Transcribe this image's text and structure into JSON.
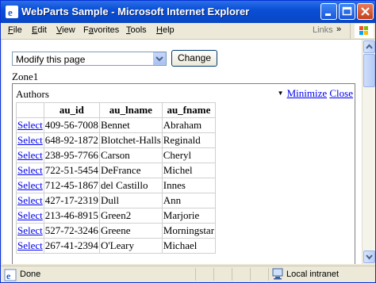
{
  "window": {
    "title": "WebParts Sample - Microsoft Internet Explorer"
  },
  "menu": {
    "items": [
      {
        "key": "F",
        "rest": "ile"
      },
      {
        "key": "E",
        "rest": "dit"
      },
      {
        "key": "V",
        "rest": "iew"
      },
      {
        "key": "F",
        "rest": "avorites",
        "pre": "F",
        "full": "Favorites"
      },
      {
        "key": "T",
        "rest": "ools"
      },
      {
        "key": "H",
        "rest": "elp"
      }
    ],
    "links_label": "Links",
    "chevron": "»"
  },
  "page": {
    "mode_select": {
      "value": "Modify this page"
    },
    "change_label": "Change",
    "zone_label": "Zone1",
    "part": {
      "title": "Authors",
      "verbs_arrow": "▼",
      "minimize_label": "Minimize",
      "close_label": "Close",
      "columns": [
        "",
        "au_id",
        "au_lname",
        "au_fname"
      ],
      "select_label": "Select",
      "rows": [
        [
          "409-56-7008",
          "Bennet",
          "Abraham"
        ],
        [
          "648-92-1872",
          "Blotchet-Halls",
          "Reginald"
        ],
        [
          "238-95-7766",
          "Carson",
          "Cheryl"
        ],
        [
          "722-51-5454",
          "DeFrance",
          "Michel"
        ],
        [
          "712-45-1867",
          "del Castillo",
          "Innes"
        ],
        [
          "427-17-2319",
          "Dull",
          "Ann"
        ],
        [
          "213-46-8915",
          "Green2",
          "Marjorie"
        ],
        [
          "527-72-3246",
          "Greene",
          "Morningstar"
        ],
        [
          "267-41-2394",
          "O'Leary",
          "Michael"
        ]
      ]
    }
  },
  "status": {
    "text": "Done",
    "zone": "Local intranet"
  },
  "colors": {
    "title_bar": "#0a4fd6",
    "link": "#0000ee"
  }
}
